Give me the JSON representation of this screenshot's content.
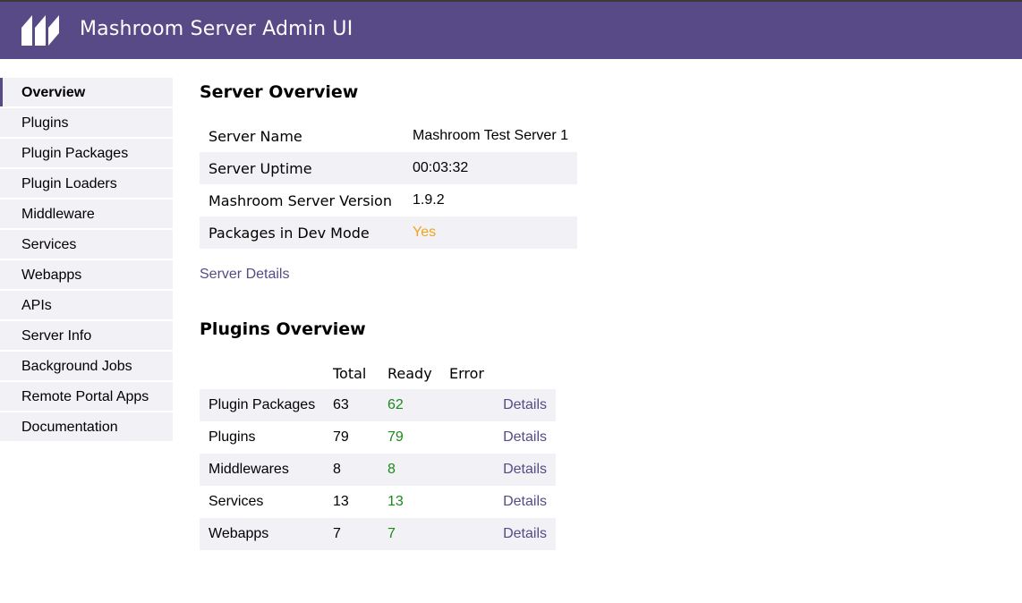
{
  "header": {
    "title": "Mashroom Server Admin UI",
    "logo_icon": "mashroom-logo-icon",
    "background_color": "#574a87"
  },
  "sidebar": {
    "items": [
      {
        "label": "Overview",
        "active": true
      },
      {
        "label": "Plugins"
      },
      {
        "label": "Plugin Packages"
      },
      {
        "label": "Plugin Loaders"
      },
      {
        "label": "Middleware"
      },
      {
        "label": "Services"
      },
      {
        "label": "Webapps"
      },
      {
        "label": "APIs"
      },
      {
        "label": "Server Info"
      },
      {
        "label": "Background Jobs"
      },
      {
        "label": "Remote Portal Apps"
      },
      {
        "label": "Documentation"
      }
    ]
  },
  "server_overview": {
    "title": "Server Overview",
    "rows": [
      {
        "key": "Server Name",
        "value": "Mashroom Test Server 1"
      },
      {
        "key": "Server Uptime",
        "value": "00:03:32"
      },
      {
        "key": "Mashroom Server Version",
        "value": "1.9.2"
      },
      {
        "key": "Packages in Dev Mode",
        "value": "Yes"
      }
    ],
    "dev_mode_color": "#f0a41e",
    "details_link": "Server Details"
  },
  "plugins_overview": {
    "title": "Plugins Overview",
    "columns": [
      "",
      "Total",
      "Ready",
      "Error",
      ""
    ],
    "rows": [
      {
        "name": "Plugin Packages",
        "total": "63",
        "ready": "62",
        "error": "",
        "details": "Details"
      },
      {
        "name": "Plugins",
        "total": "79",
        "ready": "79",
        "error": "",
        "details": "Details"
      },
      {
        "name": "Middlewares",
        "total": "8",
        "ready": "8",
        "error": "",
        "details": "Details"
      },
      {
        "name": "Services",
        "total": "13",
        "ready": "13",
        "error": "",
        "details": "Details"
      },
      {
        "name": "Webapps",
        "total": "7",
        "ready": "7",
        "error": "",
        "details": "Details"
      }
    ],
    "ready_color": "#1a8a1a"
  }
}
